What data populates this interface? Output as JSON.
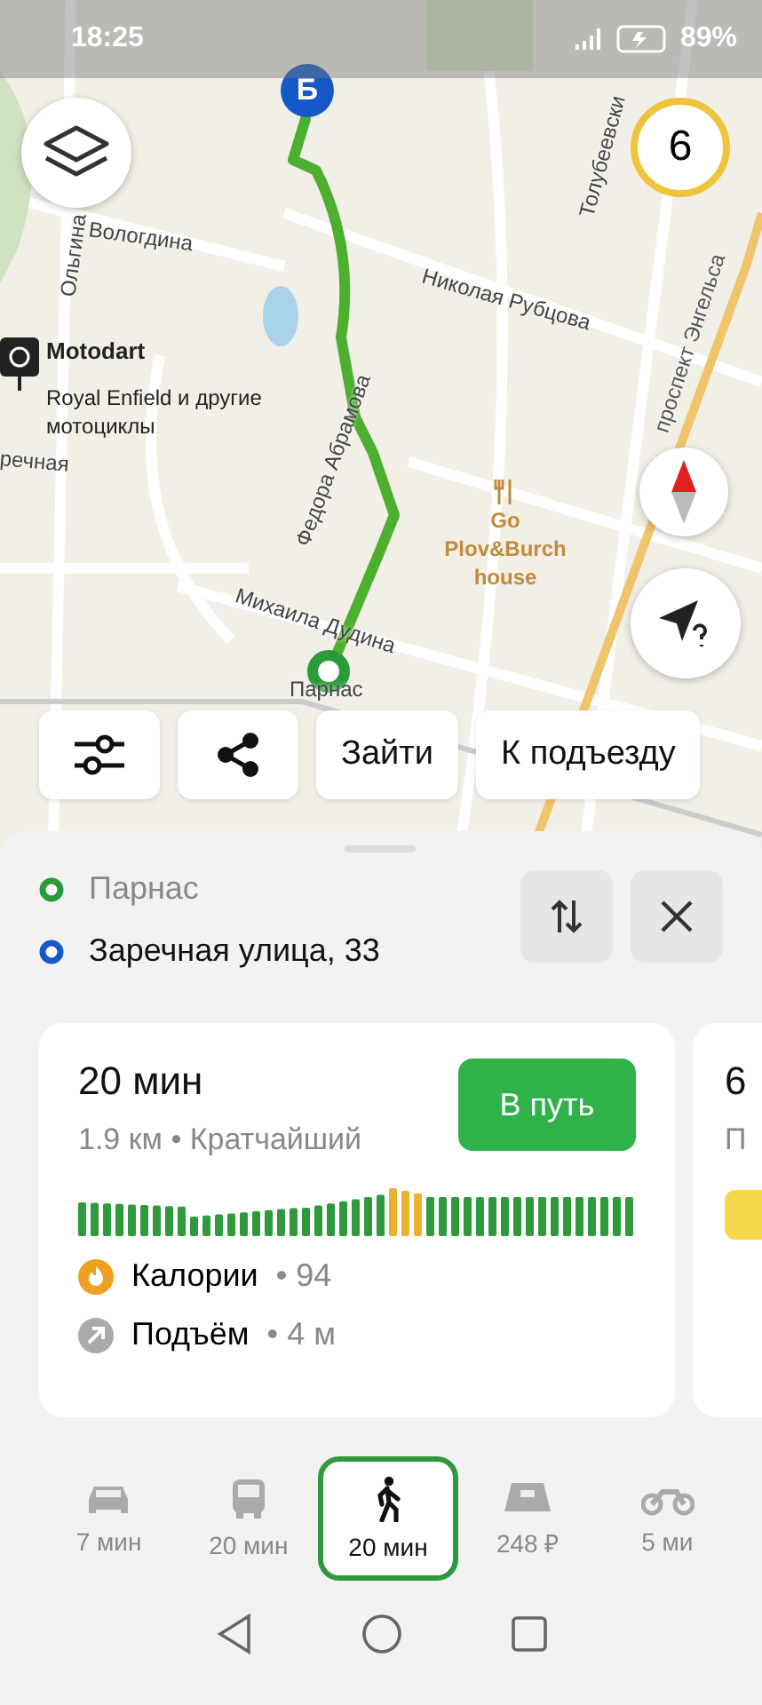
{
  "status_bar": {
    "time": "18:25",
    "battery": "89%"
  },
  "map": {
    "destination_marker": "Б",
    "speed_limit": "6",
    "labels": [
      {
        "text": "Ольгина"
      },
      {
        "text": "Вологдина"
      },
      {
        "text": "Николая Рубцова"
      },
      {
        "text": "Толубеевски"
      },
      {
        "text": "проспект Энгельса"
      },
      {
        "text": "речная"
      },
      {
        "text": "Федора Абрамова"
      },
      {
        "text": "Михаила Дудина"
      }
    ],
    "stop_label": "Парнас",
    "places": [
      {
        "name": "Motodart",
        "description": "Royal Enfield и другие мотоциклы",
        "kind": "shop"
      },
      {
        "name": "Go Plov&Burch house",
        "kind": "food"
      }
    ]
  },
  "map_actions": [
    {
      "kind": "filters"
    },
    {
      "kind": "share"
    },
    {
      "kind": "text",
      "label": "Зайти"
    },
    {
      "kind": "text",
      "label": "К подъезду"
    }
  ],
  "route_points": [
    {
      "name": "Парнас",
      "kind": "start"
    },
    {
      "name": "Заречная улица, 33",
      "kind": "end"
    }
  ],
  "route_card": {
    "time": "20 мин",
    "details": "1.9 км • Кратчайший",
    "go_button": "В путь",
    "stats": [
      {
        "kind": "calories",
        "label": "Калории",
        "value": "• 94"
      },
      {
        "kind": "climb",
        "label": "Подъём",
        "value": "• 4 м"
      }
    ]
  },
  "next_card": {
    "time": "6",
    "details": "П"
  },
  "transport_modes": [
    {
      "kind": "car",
      "label": "7 мин",
      "selected": false
    },
    {
      "kind": "bus",
      "label": "20 мин",
      "selected": false
    },
    {
      "kind": "walk",
      "label": "20 мин",
      "selected": true
    },
    {
      "kind": "taxi",
      "label": "248 ₽",
      "selected": false
    },
    {
      "kind": "moto",
      "label": "5 ми",
      "selected": false
    }
  ]
}
